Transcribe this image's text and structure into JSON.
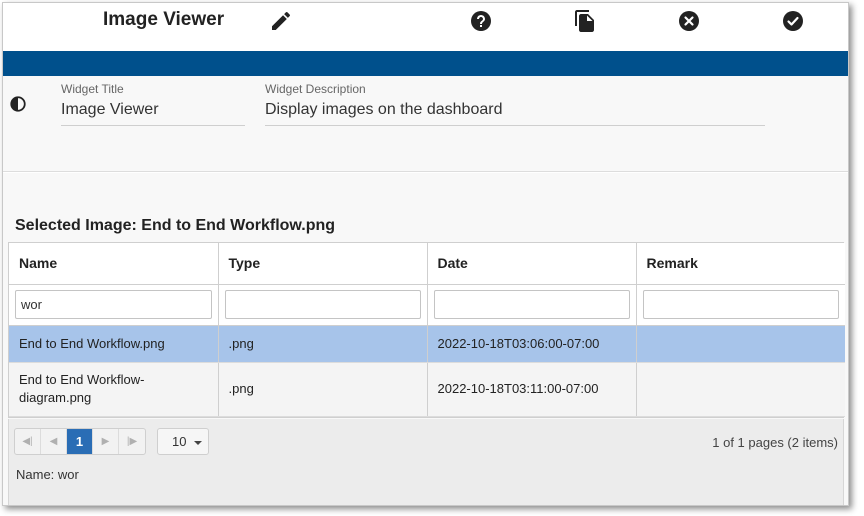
{
  "header": {
    "title": "Image Viewer",
    "icons": [
      "pencil-icon",
      "help-icon",
      "copy-icon",
      "close-circle-icon",
      "check-circle-icon"
    ]
  },
  "colors": {
    "accent_bar": "#00508c",
    "selected_row": "#a7c4ea",
    "current_page": "#2a6db5"
  },
  "settings": {
    "title_label": "Widget Title",
    "title_value": "Image Viewer",
    "description_label": "Widget Description",
    "description_value": "Display images on the dashboard"
  },
  "selected_image": "Selected Image: End to End Workflow.png",
  "grid": {
    "columns": [
      "Name",
      "Type",
      "Date",
      "Remark"
    ],
    "filters": [
      "wor",
      "",
      "",
      ""
    ],
    "rows": [
      {
        "name": "End to End Workflow.png",
        "type": ".png",
        "date": "2022-10-18T03:06:00-07:00",
        "remark": ""
      },
      {
        "name": "End to End Workflow-diagram.png",
        "type": ".png",
        "date": "2022-10-18T03:11:00-07:00",
        "remark": ""
      }
    ]
  },
  "pager": {
    "current_page": "1",
    "page_size": "10",
    "info": "1 of 1 pages (2 items)"
  },
  "filter_summary": "Name: wor"
}
